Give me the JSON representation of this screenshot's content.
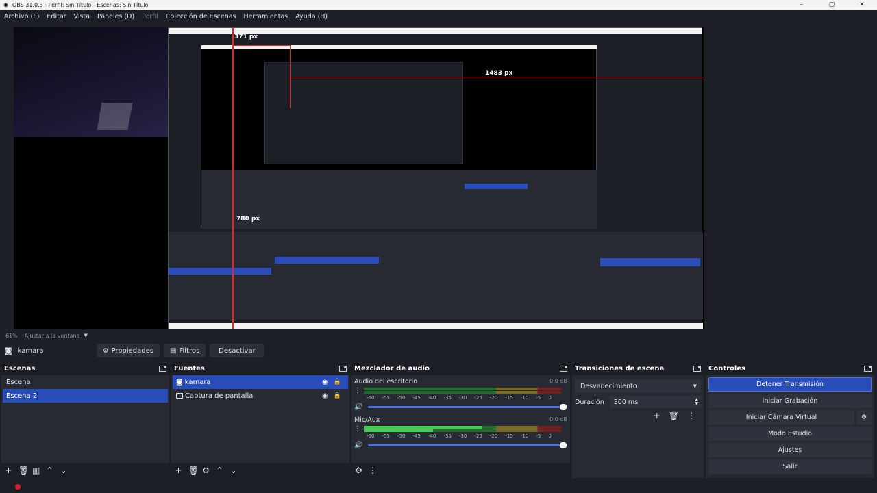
{
  "window": {
    "title": "OBS 31.0.3 - Perfil: Sin Título - Escenas: Sin Título",
    "minimize": "–",
    "maximize": "▢",
    "close": "✕"
  },
  "menu": [
    {
      "label": "Archivo (F)",
      "enabled": true
    },
    {
      "label": "Editar",
      "enabled": true
    },
    {
      "label": "Vista",
      "enabled": true
    },
    {
      "label": "Paneles (D)",
      "enabled": true
    },
    {
      "label": "Perfil",
      "enabled": false
    },
    {
      "label": "Colección de Escenas",
      "enabled": true
    },
    {
      "label": "Herramientas",
      "enabled": true
    },
    {
      "label": "Ayuda (H)",
      "enabled": true
    }
  ],
  "preview": {
    "measure_labels": [
      "371 px",
      "1483 px",
      "780 px"
    ],
    "zoom_text": "61%",
    "fit_label": "Ajustar a la ventana"
  },
  "context": {
    "source_name": "kamara",
    "properties_label": "Propiedades",
    "filters_label": "Filtros",
    "deactivate_label": "Desactivar"
  },
  "scenes": {
    "title": "Escenas",
    "items": [
      "Escena",
      "Escena 2"
    ],
    "selected_index": 1
  },
  "sources": {
    "title": "Fuentes",
    "items": [
      {
        "label": "kamara",
        "selected": true
      },
      {
        "label": "Captura de pantalla",
        "selected": false
      }
    ]
  },
  "mixer": {
    "title": "Mezclador de audio",
    "channels": [
      {
        "name": "Audio del escritorio",
        "db": "0.0 dB"
      },
      {
        "name": "Mic/Aux",
        "db": "0.0 dB"
      }
    ],
    "ticks": [
      "-60",
      "-55",
      "-50",
      "-45",
      "-40",
      "-35",
      "-30",
      "-25",
      "-20",
      "-15",
      "-10",
      "-5",
      "0"
    ]
  },
  "transitions": {
    "title": "Transiciones de escena",
    "selected": "Desvanecimiento",
    "duration_label": "Duración",
    "duration_value": "300 ms"
  },
  "controls": {
    "title": "Controles",
    "buttons": [
      "Detener Transmisión",
      "Iniciar Grabación",
      "Iniciar Cámara Virtual",
      "Modo Estudio",
      "Ajustes",
      "Salir"
    ]
  },
  "colors": {
    "accent": "#284cb8",
    "measure_red": "#ff1a1a",
    "background": "#1d1f26",
    "dock": "#272a33"
  }
}
